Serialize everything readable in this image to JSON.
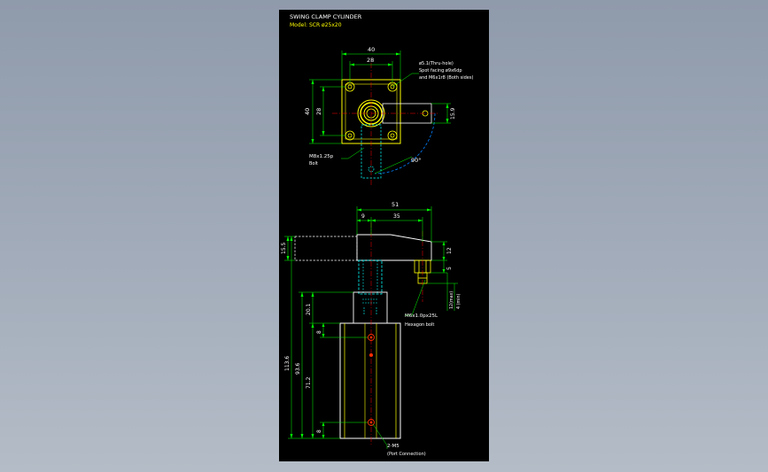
{
  "title": "SWING CLAMP CYLINDER",
  "model": "Model:  SCR  ø25x20",
  "colors": {
    "background": "#000000",
    "outline": "#ffff00",
    "dimension": "#00ff00",
    "annotation": "#ffffff",
    "hidden_line": "#00ffff",
    "center_line": "#ff0000",
    "swing_arc": "#0080ff",
    "port": "#ff3300"
  },
  "top_view": {
    "dim_40_horizontal": "40",
    "dim_28_horizontal": "28",
    "dim_40_vertical": "40",
    "dim_28_vertical": "28",
    "dim_15_9": "15.9",
    "angle": "90°",
    "note_hole_1": "ø5.1(Thru-hole)",
    "note_hole_2": "Spot facing ø9x6dp",
    "note_hole_3": "and M6x1r8 (Both sides)",
    "bolt_label": "M8x1.25p",
    "bolt_sub": "Bolt"
  },
  "side_view": {
    "dim_51": "51",
    "dim_9": "9",
    "dim_35": "35",
    "dim_15_5": "15.5",
    "dim_5": "5",
    "dim_12": "12",
    "dim_12max": "12(max)",
    "dim_4min": "4 (min)",
    "dim_20_1": "20.1",
    "dim_8_upper": "8",
    "dim_113_6": "113.6",
    "dim_93_6": "93.6",
    "dim_71_2": "71.2",
    "dim_8_lower": "8",
    "bolt_label": "M6x1.0px25L",
    "bolt_sub": "Hexagon bolt",
    "port_label": "2-M5",
    "port_sub": "(Port Connection)"
  }
}
